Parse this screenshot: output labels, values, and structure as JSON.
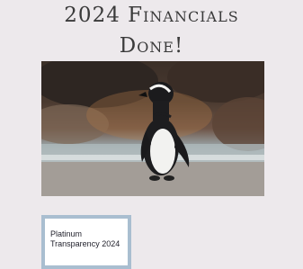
{
  "header": {
    "title_line1": "2024 Financials",
    "title_line2": "Done!"
  },
  "badge": {
    "label": "Platinum Transparency 2024"
  },
  "colors": {
    "background": "#ede9ec",
    "badge_border": "#a9bed0"
  }
}
